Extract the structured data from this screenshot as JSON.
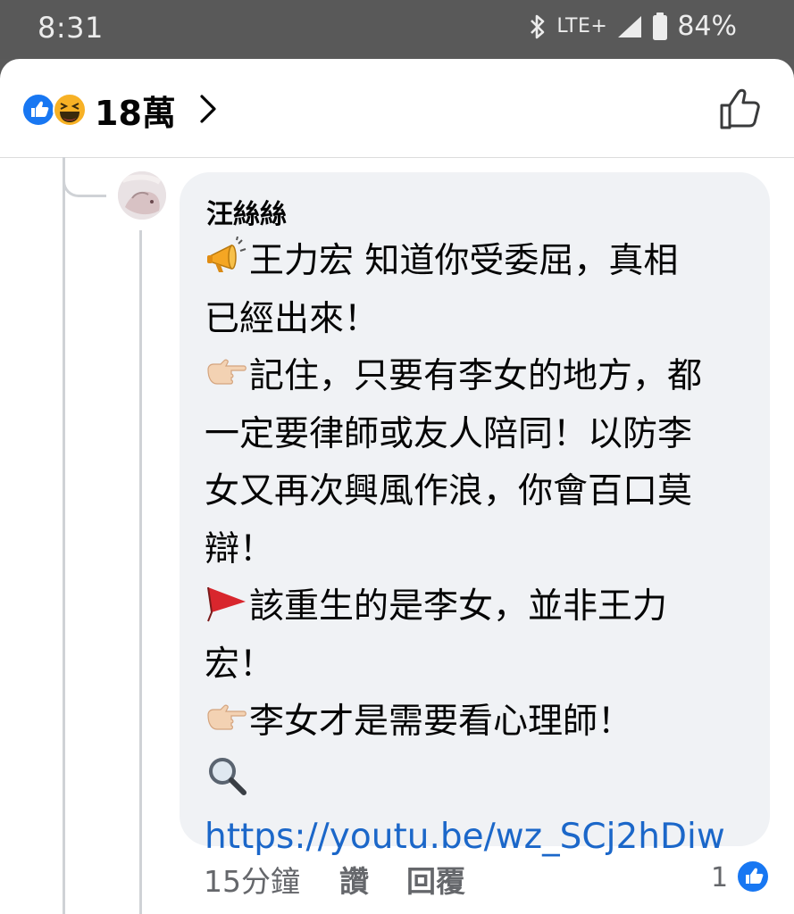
{
  "status_bar": {
    "time": "8:31",
    "network": "LTE+",
    "battery": "84%"
  },
  "header": {
    "reaction_icons": [
      "like-reaction-icon",
      "haha-reaction-icon"
    ],
    "reaction_count": "18萬"
  },
  "comment": {
    "author": "汪絲絲",
    "lines": [
      "王力宏 知道你受委屈，真相",
      "已經出來！",
      "記住，只要有李女的地方，都",
      "一定要律師或友人陪同！以防李",
      "女又再次興風作浪，你會百口莫",
      "辯！",
      "該重生的是李女，並非王力",
      "宏！",
      "李女才是需要看心理師！"
    ],
    "link": "https://youtu.be/wz_SCj2hDiw",
    "time": "15分鐘",
    "like_label": "讚",
    "reply_label": "回覆",
    "like_count": "1"
  },
  "colors": {
    "status_bar": "#595959",
    "bubble": "#f0f2f5",
    "link": "#1b67c9",
    "like_blue": "#1877f2"
  }
}
